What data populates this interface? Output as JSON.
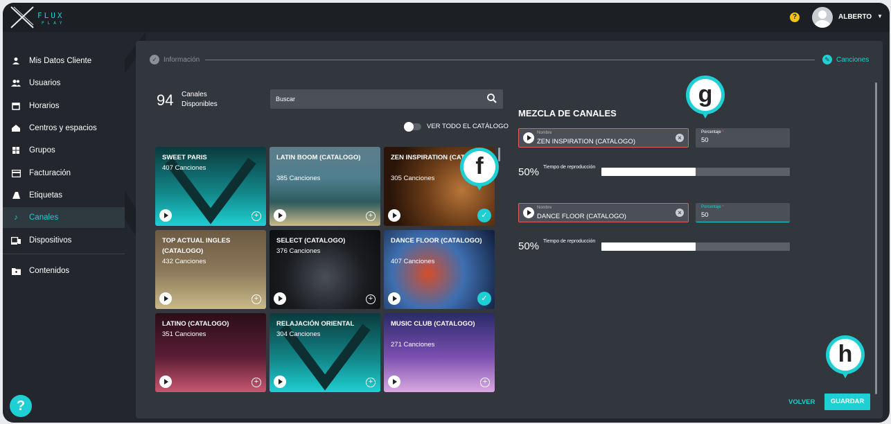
{
  "app": {
    "logo_word": "FLUX",
    "logo_sub": "PLAY"
  },
  "user": {
    "name": "ALBERTO",
    "help": "?"
  },
  "sidebar": {
    "items": [
      {
        "label": "Mis Datos Cliente",
        "icon": "person-icon"
      },
      {
        "label": "Usuarios",
        "icon": "users-icon"
      },
      {
        "label": "Horarios",
        "icon": "calendar-icon"
      },
      {
        "label": "Centros y espacios",
        "icon": "building-icon"
      },
      {
        "label": "Grupos",
        "icon": "grid-icon"
      },
      {
        "label": "Facturación",
        "icon": "card-icon"
      },
      {
        "label": "Etiquetas",
        "icon": "tags-icon"
      },
      {
        "label": "Canales",
        "icon": "music-note-icon",
        "active": true
      },
      {
        "label": "Dispositivos",
        "icon": "devices-icon"
      },
      {
        "label": "Contenidos",
        "icon": "folder-icon"
      }
    ],
    "help_fab": "?"
  },
  "stepper": {
    "step1": "Información",
    "step2": "Canciones"
  },
  "catalog": {
    "count": "94",
    "count_label": "Canales Disponibles",
    "search_placeholder": "Buscar",
    "toggle_label": "VER TODO EL CATÁLOGO",
    "cards": [
      {
        "title": "SWEET PARIS",
        "songs": "407 Canciones",
        "selected": false,
        "bg": "teal"
      },
      {
        "title": "LATIN BOOM (CATALOGO)",
        "songs": "385 Canciones",
        "selected": false,
        "bg": "beach"
      },
      {
        "title": "ZEN INSPIRATION (CATALOGO)",
        "songs": "305 Canciones",
        "selected": true,
        "bg": "zen"
      },
      {
        "title": "TOP ACTUAL INGLES (CATALOGO)",
        "songs": "432 Canciones",
        "selected": false,
        "bg": "guitar"
      },
      {
        "title": "SELECT (CATALOGO)",
        "songs": "376 Canciones",
        "selected": false,
        "bg": "dark"
      },
      {
        "title": "DANCE FLOOR (CATALOGO)",
        "songs": "407 Canciones",
        "selected": true,
        "bg": "dance"
      },
      {
        "title": "LATINO (CATALOGO)",
        "songs": "351 Canciones",
        "selected": false,
        "bg": "latino"
      },
      {
        "title": "RELAJACIÓN ORIENTAL",
        "songs": "304 Canciones",
        "selected": false,
        "bg": "teal"
      },
      {
        "title": "MUSIC CLUB (CATALOGO)",
        "songs": "271 Canciones",
        "selected": false,
        "bg": "club"
      }
    ]
  },
  "mix": {
    "title": "MEZCLA DE CANALES",
    "entries": [
      {
        "name_label": "Nombre",
        "name": "ZEN INSPIRATION (CATALOGO)",
        "pct_label": "Porcentaje",
        "pct_value": "50",
        "share": "50%",
        "share_label": "Tiempo de reproducción",
        "share_fraction": 0.5,
        "focused": false
      },
      {
        "name_label": "Nombre",
        "name": "DANCE FLOOR (CATALOGO)",
        "pct_label": "Porcentaje",
        "pct_value": "50",
        "share": "50%",
        "share_label": "Tiempo de reproducción",
        "share_fraction": 0.5,
        "focused": true
      }
    ]
  },
  "actions": {
    "back": "VOLVER",
    "save": "GUARDAR"
  },
  "callouts": {
    "f": "f",
    "g": "g",
    "h": "h"
  },
  "colors": {
    "accent": "#1ecfd3",
    "bg": "#23272d",
    "panel": "#32373e",
    "error": "#e35d5d"
  }
}
